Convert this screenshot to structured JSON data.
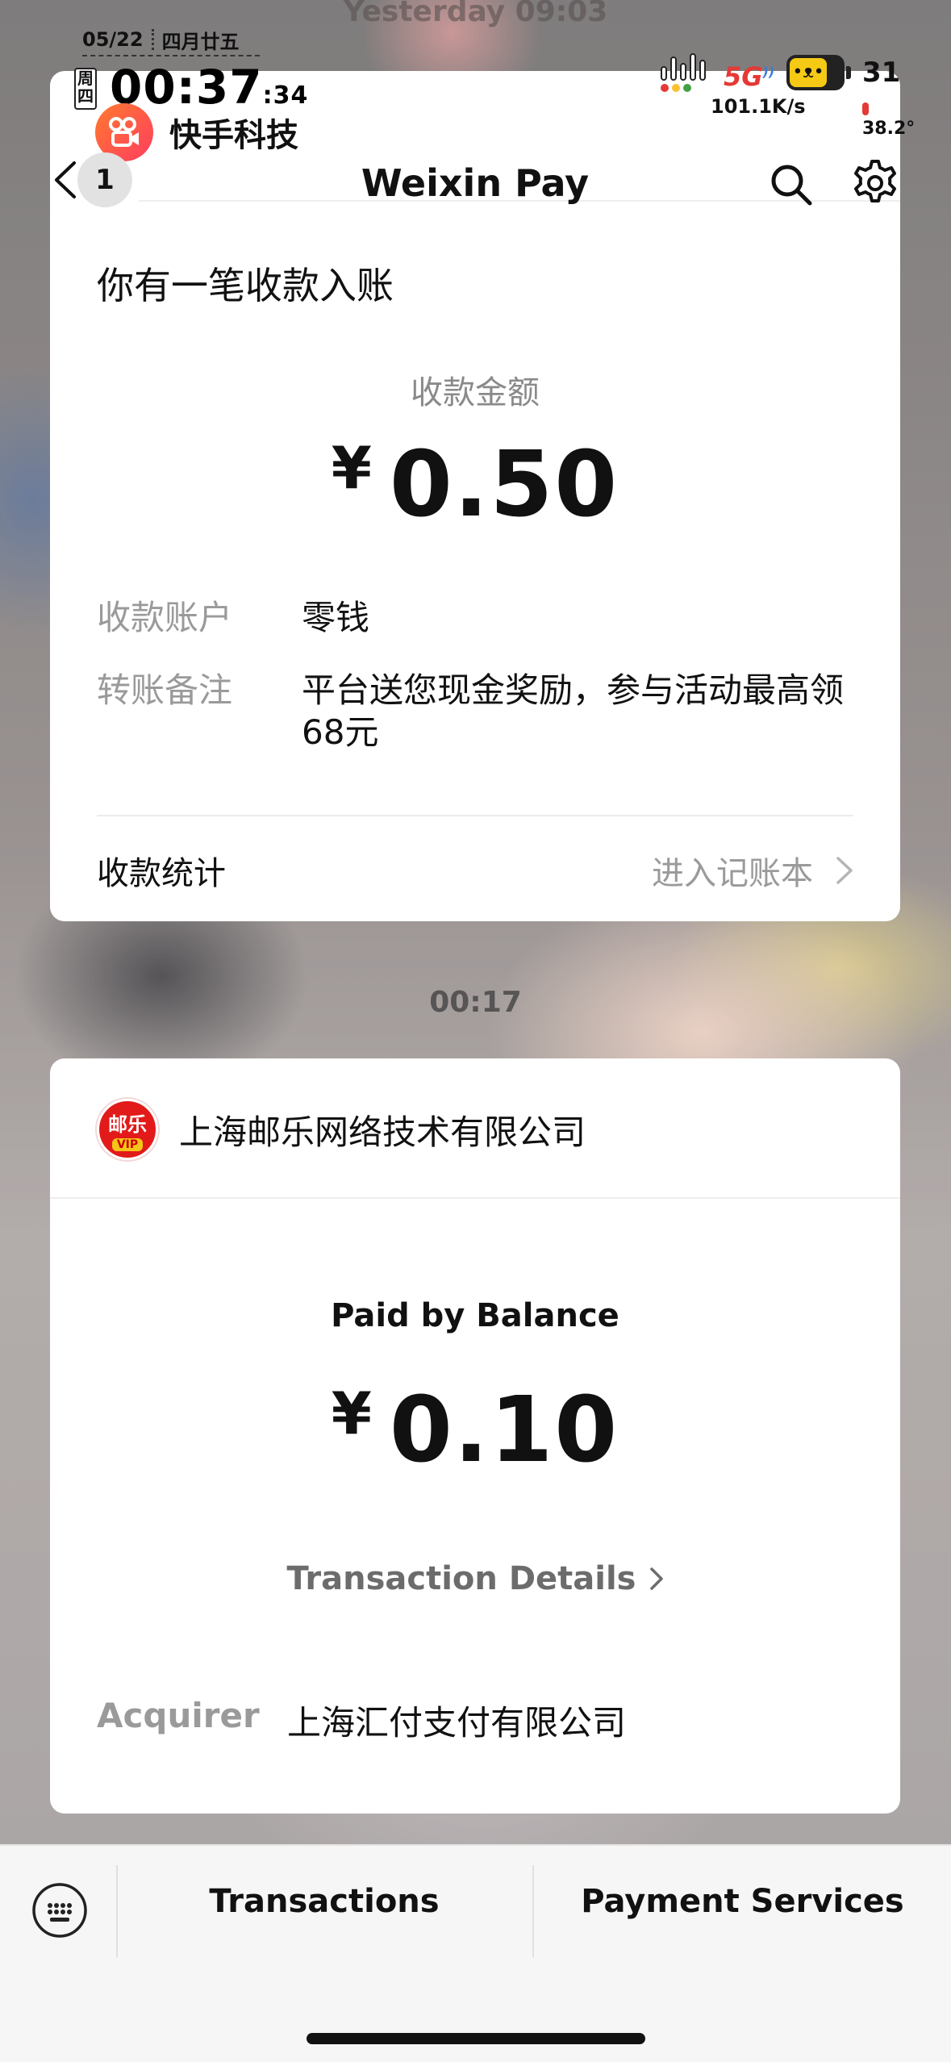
{
  "background": {
    "ghost_time": "Yesterday 09:03"
  },
  "status_bar": {
    "date": "05/22",
    "lunar_date": "四月廿五",
    "weekday": "周四",
    "time": "00:37",
    "seconds": ":34",
    "network": "5G",
    "net_speed": "101.1K/s",
    "battery_level": "31",
    "temperature": "38.2°"
  },
  "app_tag": {
    "name": "快手科技"
  },
  "header": {
    "badge_count": "1",
    "title": "Weixin Pay"
  },
  "receipt_card": {
    "title": "你有一笔收款入账",
    "amount_label": "收款金额",
    "currency": "¥",
    "amount": "0.50",
    "account_label": "收款账户",
    "account_value": "零钱",
    "note_label": "转账备注",
    "note_value": "平台送您现金奖励，参与活动最高领68元",
    "stats_label": "收款统计",
    "stats_link": "进入记账本"
  },
  "message_time": "00:17",
  "payment_card": {
    "merchant_name": "上海邮乐网络技术有限公司",
    "merchant_logo_text": "邮乐",
    "merchant_logo_badge": "VIP",
    "method_label": "Paid by Balance",
    "currency": "¥",
    "amount": "0.10",
    "details_link": "Transaction Details",
    "acquirer_label": "Acquirer",
    "acquirer_value": "上海汇付支付有限公司"
  },
  "bottom_bar": {
    "transactions": "Transactions",
    "payment_services": "Payment Services"
  },
  "colors": {
    "brand_red": "#e21a1a",
    "kuaishou_orange": "#ff5a3c",
    "muted_text": "#9a9a9a"
  }
}
